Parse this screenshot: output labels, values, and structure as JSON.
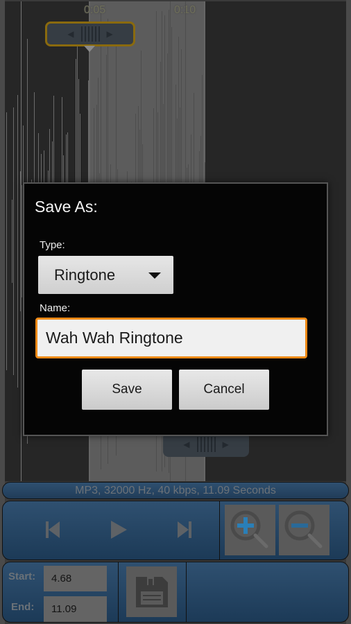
{
  "waveform": {
    "time_labels": [
      "0:05",
      "0:10"
    ]
  },
  "dialog": {
    "title": "Save As:",
    "type_label": "Type:",
    "type_selected": "Ringtone",
    "name_label": "Name:",
    "name_value": "Wah Wah Ringtone",
    "save_label": "Save",
    "cancel_label": "Cancel"
  },
  "info": {
    "text": "MP3, 32000 Hz, 40 kbps, 11.09 Seconds"
  },
  "transport": {
    "icons": [
      "skip-previous-icon",
      "play-icon",
      "skip-next-icon",
      "zoom-in-icon",
      "zoom-out-icon"
    ]
  },
  "trim": {
    "start_label": "Start:",
    "start_value": "4.68",
    "end_label": "End:",
    "end_value": "11.09",
    "save_icon": "floppy-disk-icon"
  },
  "colors": {
    "accent_orange": "#f08a16",
    "panel_blue": "#2f5070",
    "zoom_plus_blue": "#2a7fb8"
  }
}
